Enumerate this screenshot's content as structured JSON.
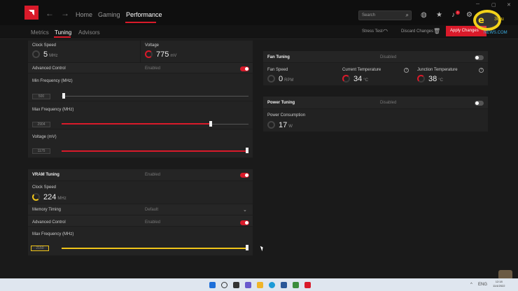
{
  "nav": {
    "home": "Home",
    "gaming": "Gaming",
    "performance": "Performance",
    "search_placeholder": "Search",
    "notif_count": "1"
  },
  "subnav": {
    "metrics": "Metrics",
    "tuning": "Tuning",
    "advisors": "Advisors",
    "stress_test": "Stress Test",
    "discard": "Discard Changes",
    "apply": "Apply Changes"
  },
  "watermark": {
    "brand": "e",
    "sub": "3d.u",
    "domain": "NEWS.COM"
  },
  "gpu": {
    "clock_speed_label": "Clock Speed",
    "clock_speed_value": "5",
    "clock_speed_unit": "MHz",
    "voltage_label": "Voltage",
    "voltage_value": "775",
    "voltage_unit": "mV",
    "advanced_control_label": "Advanced Control",
    "advanced_control_state": "Enabled",
    "min_freq_label": "Min Frequency (MHz)",
    "min_freq_value": "500",
    "min_freq_fraction": 0.0,
    "max_freq_label": "Max Frequency (MHz)",
    "max_freq_value": "2904",
    "max_freq_fraction": 0.8,
    "voltage_mv_label": "Voltage (mV)",
    "voltage_mv_value": "1175",
    "voltage_mv_fraction": 1.0
  },
  "vram": {
    "title": "VRAM Tuning",
    "state": "Enabled",
    "clock_speed_label": "Clock Speed",
    "clock_speed_value": "224",
    "clock_speed_unit": "MHz",
    "memory_timing_label": "Memory Timing",
    "memory_timing_value": "Default",
    "advanced_control_label": "Advanced Control",
    "advanced_control_state": "Enabled",
    "max_freq_label": "Max Frequency (MHz)",
    "max_freq_value": "2150",
    "max_freq_fraction": 1.0
  },
  "fan": {
    "title": "Fan Tuning",
    "state": "Disabled",
    "fan_speed_label": "Fan Speed",
    "fan_speed_value": "0",
    "fan_speed_unit": "RPM",
    "current_temp_label": "Current Temperature",
    "current_temp_value": "34",
    "current_temp_unit": "°C",
    "junction_temp_label": "Junction Temperature",
    "junction_temp_value": "38",
    "junction_temp_unit": "°C"
  },
  "power": {
    "title": "Power Tuning",
    "state": "Disabled",
    "consumption_label": "Power Consumption",
    "consumption_value": "17",
    "consumption_unit": "W"
  },
  "taskbar": {
    "time": "12:18",
    "date": "11/4/2022",
    "lang": "ENG"
  },
  "colors": {
    "accent": "#d91a2a",
    "vram_accent": "#f0c419"
  }
}
